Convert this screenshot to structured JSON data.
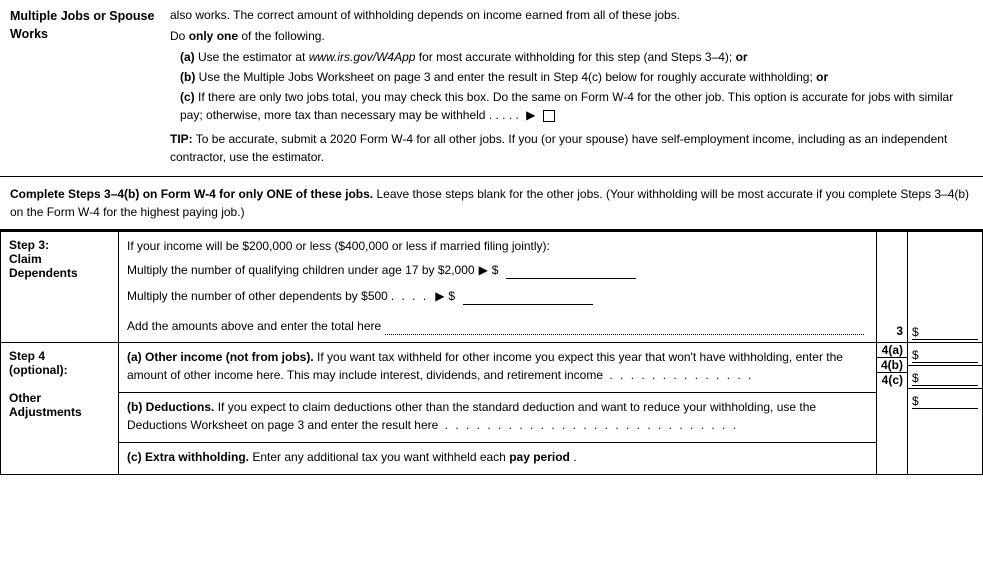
{
  "top": {
    "left_label": "Multiple Jobs or Spouse Works",
    "intro": "also works. The correct amount of withholding depends on income earned from all of these jobs.",
    "do_one": "Do ",
    "do_one_bold": "only one",
    "do_one_rest": " of the following.",
    "item_a_label": "(a)",
    "item_a_text": " Use the estimator at ",
    "item_a_url": "www.irs.gov/W4App",
    "item_a_rest": " for most accurate withholding for this step (and Steps 3–4); ",
    "item_a_or": "or",
    "item_b_label": "(b)",
    "item_b_text": " Use the Multiple Jobs Worksheet on page 3 and enter the result in Step 4(c) below for roughly accurate withholding; ",
    "item_b_or": "or",
    "item_c_label": "(c)",
    "item_c_text": " If there are only two jobs total, you may check this box. Do the same on Form W-4 for the other job. This option is accurate for jobs with similar pay; otherwise, more tax than necessary may be withheld . . . . .",
    "tip_bold": "TIP:",
    "tip_text": " To be accurate, submit a 2020 Form W-4 for all other jobs. If you (or your spouse) have self-employment income, including as an independent contractor, use the estimator."
  },
  "complete": {
    "bold_part": "Complete Steps 3–4(b) on Form W-4 for only ONE of these jobs.",
    "rest": " Leave those steps blank for the other jobs. (Your withholding will be most accurate if you complete Steps 3–4(b) on the Form W-4 for the highest paying job.)"
  },
  "step3": {
    "label_line1": "Step 3:",
    "label_line2": "Claim",
    "label_line3": "Dependents",
    "intro": "If your income will be $200,000 or less ($400,000 or less if married filing jointly):",
    "sub1_text": "Multiply the number of qualifying children under age 17 by $2,000",
    "sub1_arrow": "▶",
    "sub1_dollar": "$",
    "sub2_text": "Multiply the number of other dependents by $500",
    "sub2_dots": ". . . .",
    "sub2_arrow": "▶",
    "sub2_dollar": "$",
    "add_text": "Add the amounts above and enter the total here",
    "add_dots": ". . . . . . . . . . . . .",
    "line_num": "3",
    "line_dollar": "$"
  },
  "step4": {
    "label_line1": "Step 4",
    "label_line2": "(optional):",
    "label_line3": "Other",
    "label_line4": "Adjustments",
    "a_label": "(a)",
    "a_bold": "Other income (not from jobs).",
    "a_text": " If you want tax withheld for other income you expect this year that won't have withholding, enter the amount of other income here. This may include interest, dividends, and retirement income",
    "a_dots": ". . . . . . . . . . . . . .",
    "a_line": "4(a)",
    "a_dollar": "$",
    "b_label": "(b)",
    "b_bold": "Deductions.",
    "b_text": " If you expect to claim deductions other than the standard deduction and want to reduce your withholding, use the Deductions Worksheet on page 3 and enter the result here",
    "b_dots": ". . . . . . . . . . . . . . . . . . . . . . . . . . . .",
    "b_line": "4(b)",
    "b_dollar": "$",
    "c_label": "(c)",
    "c_bold": "Extra withholding.",
    "c_text": " Enter any additional tax you want withheld each ",
    "c_bold2": "pay period",
    "c_dots": ".",
    "c_line": "4(c)",
    "c_dollar": "$"
  }
}
